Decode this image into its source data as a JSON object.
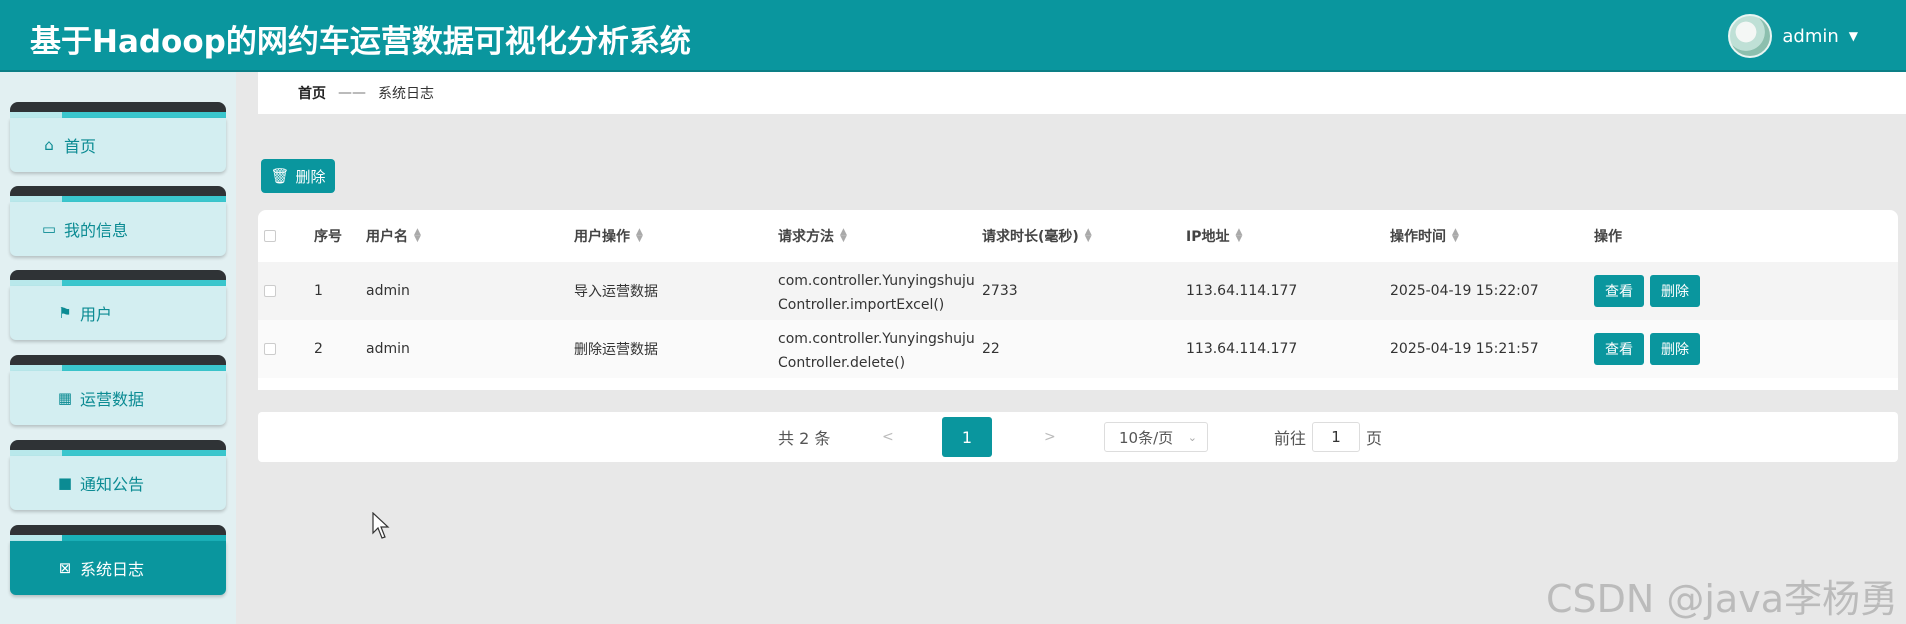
{
  "header": {
    "title": "基于Hadoop的网约车运营数据可视化分析系统",
    "username": "admin",
    "avatar_icon": "avatar-image",
    "dropdown_icon": "caret-down-icon",
    "color": "#0a969e"
  },
  "sidebar": {
    "items": [
      {
        "label": "首页",
        "icon": "home-icon"
      },
      {
        "label": "我的信息",
        "icon": "id-card-icon"
      },
      {
        "label": "用户",
        "icon": "flag-icon"
      },
      {
        "label": "运营数据",
        "icon": "grid-icon"
      },
      {
        "label": "通知公告",
        "icon": "briefcase-icon"
      },
      {
        "label": "系统日志",
        "icon": "clipboard-icon",
        "active": true
      }
    ]
  },
  "breadcrumb": {
    "home": "首页",
    "separator": "——",
    "current": "系统日志"
  },
  "toolbar": {
    "delete_label": "删除",
    "delete_icon": "trash-icon"
  },
  "table": {
    "columns": [
      "序号",
      "用户名",
      "用户操作",
      "请求方法",
      "请求时长(毫秒)",
      "IP地址",
      "操作时间",
      "操作"
    ],
    "rows": [
      {
        "index": "1",
        "username": "admin",
        "operation": "导入运营数据",
        "method_line1": "com.controller.Yunyingshuju",
        "method_line2": "Controller.importExcel()",
        "duration": "2733",
        "ip": "113.64.114.177",
        "time": "2025-04-19 15:22:07",
        "view_label": "查看",
        "delete_label": "删除"
      },
      {
        "index": "2",
        "username": "admin",
        "operation": "删除运营数据",
        "method_line1": "com.controller.Yunyingshuju",
        "method_line2": "Controller.delete()",
        "duration": "22",
        "ip": "113.64.114.177",
        "time": "2025-04-19 15:21:57",
        "view_label": "查看",
        "delete_label": "删除"
      }
    ]
  },
  "pagination": {
    "total": "共 2 条",
    "prev": "<",
    "current_page": "1",
    "next": ">",
    "page_size": "10条/页",
    "goto_label": "前往",
    "goto_value": "1",
    "page_unit": "页"
  },
  "watermark": "CSDN @java李杨勇"
}
